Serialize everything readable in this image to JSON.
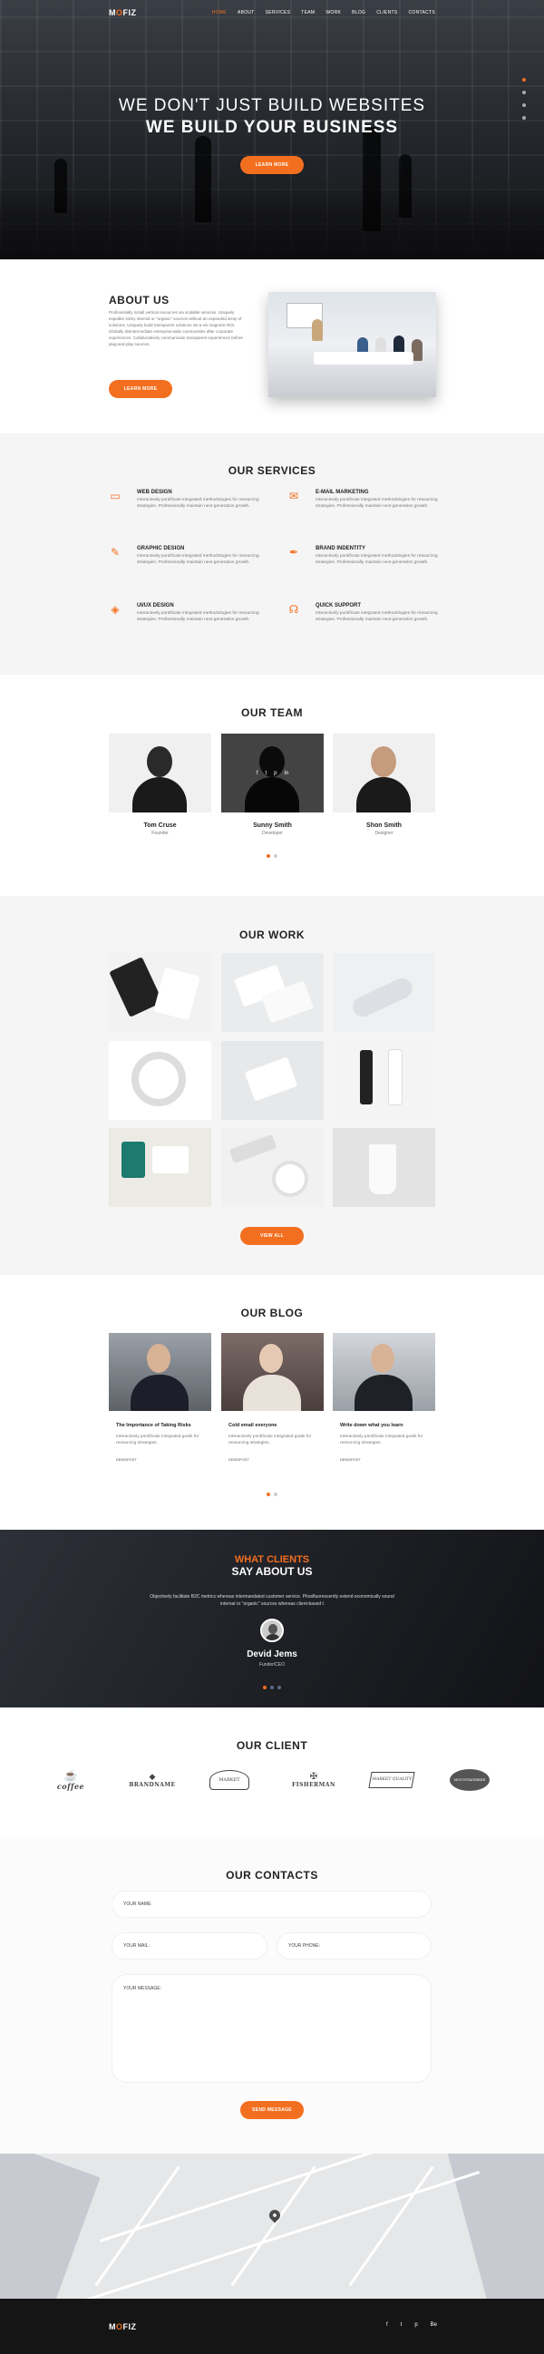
{
  "brand": {
    "logo_pre": "M",
    "logo_o": "O",
    "logo_post": "FIZ",
    "accent": "#f36f20"
  },
  "nav": [
    "HOME",
    "ABOUT",
    "SERVICES",
    "TEAM",
    "WORK",
    "BLOG",
    "CLIENTS",
    "CONTACTS"
  ],
  "hero": {
    "line1": "WE DON'T JUST BUILD WEBSITES",
    "line2": "WE BUILD YOUR BUSINESS",
    "button": "LEARN MORE"
  },
  "about": {
    "title": "ABOUT US",
    "text": "Proficientially install vertical resources via scalable services. Uniquely expedite sticky internal or \"organic\" sources without an expanded array of solutions. Uniquely build transparent solutions vis-a-vis magnetic ROI. Globally disintermediate enterprise-wide communities after corporate experiences. Collaboratively communicate transparent experiences before plug-and-play sources.",
    "button": "LEARN MORE"
  },
  "services": {
    "title": "OUR SERVICES",
    "items": [
      {
        "icon": "monitor-icon",
        "title": "WEB DESIGN",
        "text": "Interactively pontificate integrated methodologies for resourcing strategies. Professionally maintain next-generation growth."
      },
      {
        "icon": "mail-icon",
        "title": "E-MAIL MARKETING",
        "text": "Interactively pontificate integrated methodologies for resourcing strategies. Professionally maintain next-generation growth."
      },
      {
        "icon": "edit-icon",
        "title": "GRAPHIC DESIGN",
        "text": "Interactively pontificate integrated methodologies for resourcing strategies. Professionally maintain next-generation growth."
      },
      {
        "icon": "pen-icon",
        "title": "BRAND INDENTITY",
        "text": "Interactively pontificate integrated methodologies for resourcing strategies. Professionally maintain next-generation growth."
      },
      {
        "icon": "layers-icon",
        "title": "UI/UX DESIGN",
        "text": "Interactively pontificate integrated methodologies for resourcing strategies. Professionally maintain next-generation growth."
      },
      {
        "icon": "headset-icon",
        "title": "QUICK SUPPORT",
        "text": "Interactively pontificate integrated methodologies for resourcing strategies. Professionally maintain next-generation growth."
      }
    ]
  },
  "team": {
    "title": "OUR TEAM",
    "members": [
      {
        "name": "Tom Cruse",
        "role": "Founder"
      },
      {
        "name": "Sunny Smith",
        "role": "Developer",
        "social": [
          "f",
          "t",
          "p",
          "in"
        ]
      },
      {
        "name": "Shon Smith",
        "role": "Designer"
      }
    ]
  },
  "work": {
    "title": "OUR WORK",
    "button": "VIEW ALL"
  },
  "blog": {
    "title": "OUR BLOG",
    "posts": [
      {
        "title": "The Importance of Taking Risks",
        "text": "Interactively pontificate integrated goals for resourcing strategies.",
        "by": "DEMOPOST"
      },
      {
        "title": "Cold email everyone",
        "text": "Interactively pontificate integrated goals for resourcing strategies.",
        "by": "DEMOPOST"
      },
      {
        "title": "Write down what you learn",
        "text": "Interactively pontificate integrated goals for resourcing strategies.",
        "by": "DEMOPOST"
      }
    ]
  },
  "testimonial": {
    "small": "WHAT CLIENTS",
    "large": "SAY ABOUT US",
    "quote": "Objectively facilitate B2C metrics whereas intermandated customer service. Phosfluorescently extend economically sound internal or \"organic\" sources whereas client-based t",
    "name": "Devid Jems",
    "role": "Funder/CEO"
  },
  "clients": {
    "title": "OUR CLIENT",
    "logos": [
      "coffee",
      "BRANDNAME",
      "MARKET",
      "FISHERMAN",
      "MARKET QUALITY",
      "MOUNTAINBIKE"
    ]
  },
  "contacts": {
    "title": "OUR CONTACTS",
    "name": "YOUR NAME:",
    "mail": "YOUR MAIL:",
    "phone": "YOUR PHONE:",
    "message": "YOUR MESSAGE:",
    "button": "SEND MESSAGE"
  },
  "footer": {
    "social": [
      "f",
      "t",
      "p",
      "Be"
    ]
  }
}
